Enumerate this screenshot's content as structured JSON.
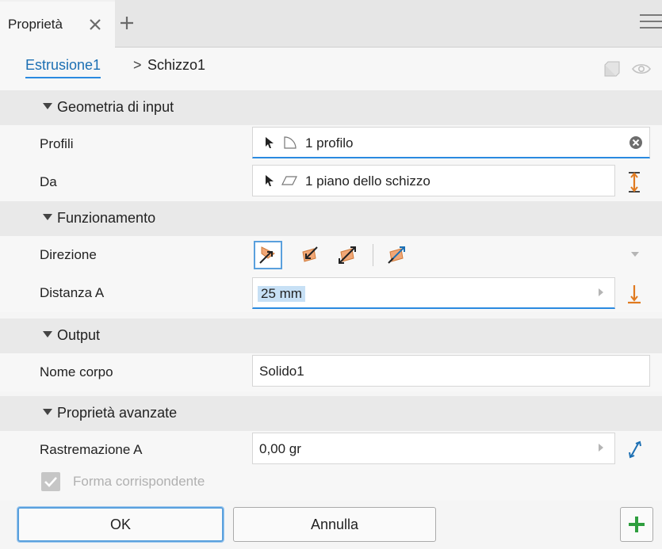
{
  "tab": {
    "title": "Proprietà"
  },
  "breadcrumb": {
    "feature": "Estrusione1",
    "separator": ">",
    "sketch": "Schizzo1"
  },
  "sections": {
    "input": "Geometria di input",
    "operation": "Funzionamento",
    "output": "Output",
    "advanced": "Proprietà avanzate"
  },
  "fields": {
    "profiles": {
      "label": "Profili",
      "value": "1 profilo"
    },
    "from": {
      "label": "Da",
      "value": "1 piano dello schizzo"
    },
    "direction": {
      "label": "Direzione"
    },
    "distance": {
      "label": "Distanza A",
      "value": "25 mm"
    },
    "body_name": {
      "label": "Nome corpo",
      "value": "Solido1"
    },
    "taper": {
      "label": "Rastremazione A",
      "value": "0,00 gr"
    },
    "match_shape": {
      "label": "Forma corrispondente",
      "checked": true
    }
  },
  "buttons": {
    "ok": "OK",
    "cancel": "Annulla"
  },
  "colors": {
    "accent": "#2a8ae0",
    "orange": "#e07a1f",
    "blue_arrow": "#1c6fb3",
    "section_bg": "#e9e9e9"
  },
  "icons": [
    "close-icon",
    "add-tab-icon",
    "menu-icon",
    "visibility-icon",
    "view-cube-icon",
    "select-arrow-icon",
    "profile-icon",
    "plane-icon",
    "clear-icon",
    "flip-icon",
    "direction-default-icon",
    "direction-flipped-icon",
    "direction-symmetric-icon",
    "direction-asymmetric-icon",
    "dropdown-icon",
    "distance-direction-icon",
    "taper-flip-icon",
    "checkbox-icon",
    "apply-plus-icon"
  ]
}
